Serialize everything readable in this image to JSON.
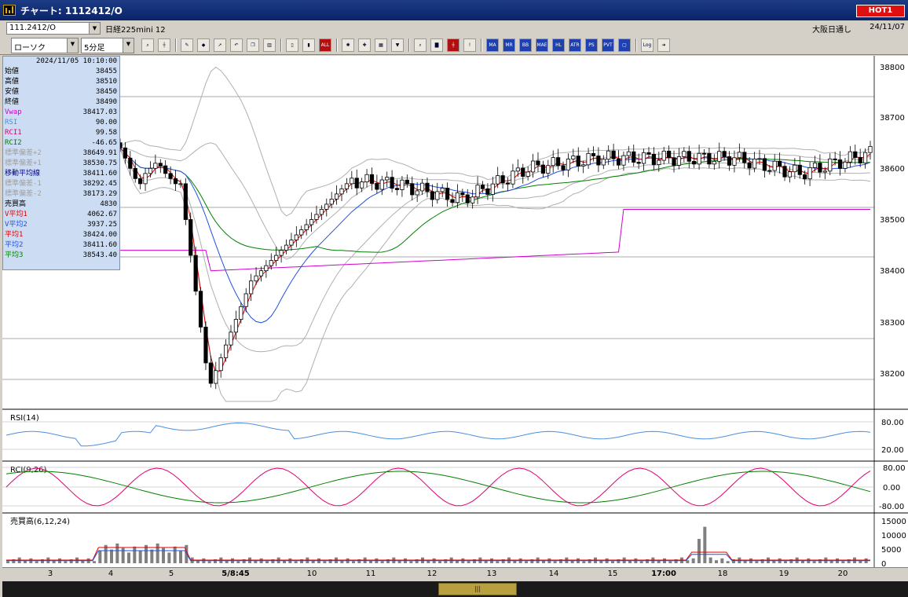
{
  "window": {
    "title": "チャート: 1112412/O",
    "hot_badge": "HOT1"
  },
  "infobar": {
    "symbol": "111.2412/O",
    "instrument": "日経225mini 12",
    "session": "大阪日通し",
    "date": "24/11/07"
  },
  "toolbar": {
    "chart_type": "ローソク",
    "interval": "5分足",
    "buttons": [
      {
        "name": "zoom-button",
        "icon": "magnifier-icon",
        "glyph": "⌕",
        "accent": ""
      },
      {
        "name": "crosshair-button",
        "icon": "crosshair-icon",
        "glyph": "┼",
        "accent": ""
      },
      {
        "name": "trendline-button",
        "icon": "pen-icon",
        "glyph": "✎",
        "accent": ""
      },
      {
        "name": "fill-button",
        "icon": "paint-icon",
        "glyph": "◆",
        "accent": ""
      },
      {
        "name": "pointer-button",
        "icon": "cursor-icon",
        "glyph": "➚",
        "accent": ""
      },
      {
        "name": "undo-button",
        "icon": "undo-icon",
        "glyph": "↶",
        "accent": ""
      },
      {
        "name": "copy-button",
        "icon": "copy-icon",
        "glyph": "❐",
        "accent": ""
      },
      {
        "name": "delete-button",
        "icon": "trash-icon",
        "glyph": "▥",
        "accent": ""
      },
      {
        "name": "candle-style-button",
        "icon": "candle-icon",
        "glyph": "▯",
        "accent": ""
      },
      {
        "name": "candle-style-2-button",
        "icon": "candle-pair-icon",
        "glyph": "▮",
        "accent": ""
      },
      {
        "name": "all-button",
        "icon": "all-icon",
        "glyph": "ALL",
        "accent": "r"
      },
      {
        "name": "settings-button",
        "icon": "gear-icon",
        "glyph": "✺",
        "accent": ""
      },
      {
        "name": "tools-button",
        "icon": "wrench-icon",
        "glyph": "✚",
        "accent": ""
      },
      {
        "name": "color-button",
        "icon": "palette-icon",
        "glyph": "▦",
        "accent": ""
      },
      {
        "name": "order-button",
        "icon": "order-icon",
        "glyph": "▼",
        "accent": ""
      },
      {
        "name": "search-button",
        "icon": "search-icon",
        "glyph": "⌕",
        "accent": ""
      },
      {
        "name": "bar-chart-button",
        "icon": "bar-chart-icon",
        "glyph": "▇",
        "accent": ""
      },
      {
        "name": "split-button",
        "icon": "split-icon",
        "glyph": "┼",
        "accent": "r"
      },
      {
        "name": "alert-button",
        "icon": "alert-icon",
        "glyph": "!",
        "accent": ""
      },
      {
        "name": "ma-button",
        "icon": "ma-icon",
        "glyph": "MA",
        "accent": "b"
      },
      {
        "name": "mr-button",
        "icon": "mr-icon",
        "glyph": "MR",
        "accent": "b"
      },
      {
        "name": "bb-button",
        "icon": "bb-icon",
        "glyph": "BB",
        "accent": "b"
      },
      {
        "name": "mae-button",
        "icon": "mae-icon",
        "glyph": "MAE",
        "accent": "b"
      },
      {
        "name": "hl-button",
        "icon": "hl-icon",
        "glyph": "HL",
        "accent": "b"
      },
      {
        "name": "atr-button",
        "icon": "atr-icon",
        "glyph": "ATR",
        "accent": "b"
      },
      {
        "name": "psar-button",
        "icon": "psar-icon",
        "glyph": "PS",
        "accent": "b"
      },
      {
        "name": "pvt-button",
        "icon": "pvt-icon",
        "glyph": "PVT",
        "accent": "b"
      },
      {
        "name": "frame-button",
        "icon": "frame-icon",
        "glyph": "▢",
        "accent": "b"
      },
      {
        "name": "log-button",
        "icon": "log-icon",
        "glyph": "Log",
        "accent": ""
      },
      {
        "name": "export-button",
        "icon": "export-icon",
        "glyph": "➜",
        "accent": ""
      }
    ]
  },
  "data_panel": {
    "timestamp": "2024/11/05  10:10:00",
    "rows": [
      {
        "label": "始値",
        "value": "38455",
        "color": "#000000"
      },
      {
        "label": "高値",
        "value": "38510",
        "color": "#000000"
      },
      {
        "label": "安値",
        "value": "38450",
        "color": "#000000"
      },
      {
        "label": "終値",
        "value": "38490",
        "color": "#000000"
      },
      {
        "label": "Vwap",
        "value": "38417.03",
        "color": "#d000d0"
      },
      {
        "label": "RSI",
        "value": "90.00",
        "color": "#4b8fe0"
      },
      {
        "label": "RCI1",
        "value": "99.58",
        "color": "#e00070"
      },
      {
        "label": "RCI2",
        "value": "-46.65",
        "color": "#008000"
      },
      {
        "label": "標準偏差+2",
        "value": "38649.91",
        "color": "#a0a0a0"
      },
      {
        "label": "標準偏差+1",
        "value": "38530.75",
        "color": "#a0a0a0"
      },
      {
        "label": "移動平均線",
        "value": "38411.60",
        "color": "#000080"
      },
      {
        "label": "標準偏差-1",
        "value": "38292.45",
        "color": "#a0a0a0"
      },
      {
        "label": "標準偏差-2",
        "value": "38173.29",
        "color": "#a0a0a0"
      },
      {
        "label": "売買高",
        "value": "4830",
        "color": "#000000"
      },
      {
        "label": "V平均1",
        "value": "4062.67",
        "color": "#e00000"
      },
      {
        "label": "V平均2",
        "value": "3937.25",
        "color": "#2050e0"
      },
      {
        "label": "平均1",
        "value": "38424.00",
        "color": "#e00000"
      },
      {
        "label": "平均2",
        "value": "38411.60",
        "color": "#2050e0"
      },
      {
        "label": "平均3",
        "value": "38543.40",
        "color": "#008000"
      }
    ]
  },
  "panes": {
    "price_ticks": [
      "38800",
      "38700",
      "38600",
      "38500",
      "38400",
      "38300",
      "38200"
    ],
    "rsi_title": "RSI(14)",
    "rsi_ticks": [
      "80.00",
      "20.00"
    ],
    "rci_title": "RCI(9,26)",
    "rci_ticks": [
      "80.00",
      "0.00",
      "-80.00"
    ],
    "vol_title": "売買高(6,12,24)",
    "vol_ticks": [
      "15000",
      "10000",
      "5000",
      "0"
    ]
  },
  "time_axis": [
    {
      "label": "3",
      "bold": false
    },
    {
      "label": "4",
      "bold": false
    },
    {
      "label": "5",
      "bold": false
    },
    {
      "label": "5/8:45",
      "bold": true
    },
    {
      "label": "10",
      "bold": false
    },
    {
      "label": "11",
      "bold": false
    },
    {
      "label": "12",
      "bold": false
    },
    {
      "label": "13",
      "bold": false
    },
    {
      "label": "14",
      "bold": false
    },
    {
      "label": "15",
      "bold": false
    },
    {
      "label": "17:00",
      "bold": true
    },
    {
      "label": "18",
      "bold": false
    },
    {
      "label": "19",
      "bold": false
    },
    {
      "label": "20",
      "bold": false
    }
  ],
  "scroll": {
    "thumb_label": "|||"
  },
  "colors": {
    "up_candle": "#ffffff",
    "down_candle": "#000000",
    "ma1": "#e00000",
    "ma2": "#2050e0",
    "ma3": "#008000",
    "vwap": "#d000d0",
    "bands": "#b0b0b0",
    "rsi": "#4b8fe0",
    "rci1": "#e00070",
    "rci2": "#008000"
  },
  "chart_data": {
    "type": "candlestick",
    "price_axis_ticks": [
      38800,
      38700,
      38600,
      38500,
      38400,
      38300,
      38200
    ],
    "candles": [
      {
        "t": "5/8:45",
        "o": 38490,
        "h": 38510,
        "l": 38170,
        "c": 38180
      },
      {
        "t": "10:00",
        "o": 38300,
        "h": 38380,
        "l": 38260,
        "c": 38370
      },
      {
        "t": "10:10",
        "o": 38455,
        "h": 38510,
        "l": 38450,
        "c": 38490
      },
      {
        "t": "11:00",
        "o": 38520,
        "h": 38600,
        "l": 38510,
        "c": 38580
      },
      {
        "t": "12:00",
        "o": 38560,
        "h": 38590,
        "l": 38520,
        "c": 38570
      },
      {
        "t": "13:00",
        "o": 38520,
        "h": 38570,
        "l": 38480,
        "c": 38540
      },
      {
        "t": "14:00",
        "o": 38580,
        "h": 38630,
        "l": 38540,
        "c": 38600
      },
      {
        "t": "15:00",
        "o": 38600,
        "h": 38640,
        "l": 38570,
        "c": 38620
      },
      {
        "t": "17:00",
        "o": 38660,
        "h": 38680,
        "l": 38600,
        "c": 38620
      },
      {
        "t": "18:00",
        "o": 38640,
        "h": 38670,
        "l": 38600,
        "c": 38620
      },
      {
        "t": "19:00",
        "o": 38600,
        "h": 38630,
        "l": 38550,
        "c": 38590
      },
      {
        "t": "20:00",
        "o": 38630,
        "h": 38650,
        "l": 38600,
        "c": 38630
      }
    ]
  }
}
